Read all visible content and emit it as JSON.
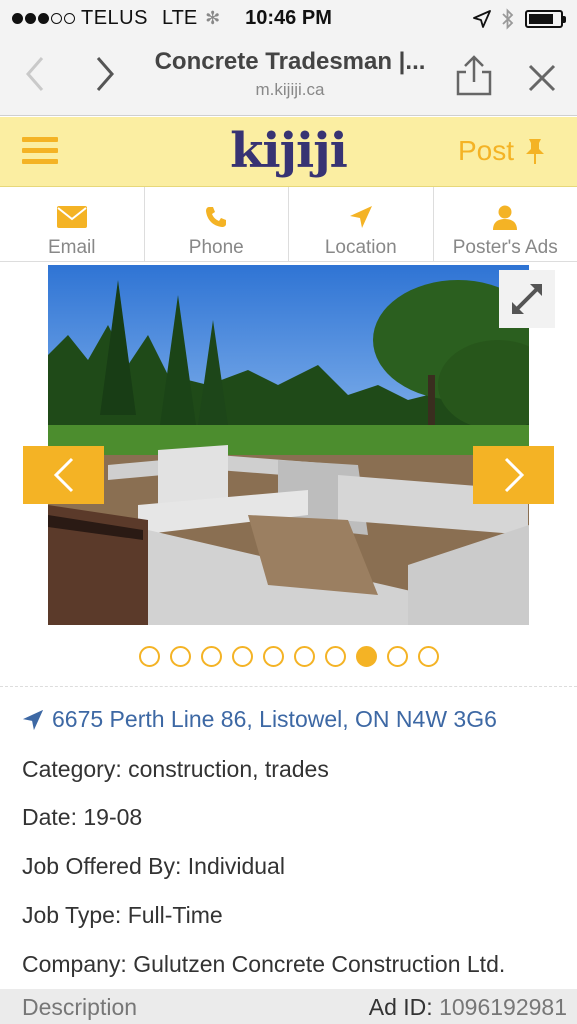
{
  "status_bar": {
    "carrier": "TELUS",
    "network": "LTE",
    "time": "10:46 PM"
  },
  "browser": {
    "title": "Concrete Tradesman |...",
    "url": "m.kijiji.ca"
  },
  "header": {
    "logo": "kijiji",
    "post_label": "Post"
  },
  "actions": [
    {
      "label": "Email",
      "icon": "envelope-icon"
    },
    {
      "label": "Phone",
      "icon": "phone-icon"
    },
    {
      "label": "Location",
      "icon": "location-arrow-icon"
    },
    {
      "label": "Poster's Ads",
      "icon": "user-icon"
    }
  ],
  "gallery": {
    "total_photos": 10,
    "current_photo": 8
  },
  "listing": {
    "address": "6675 Perth Line 86, Listowel, ON N4W 3G6",
    "category": "Category: construction, trades",
    "date": "Date: 19-08",
    "offered_by": "Job Offered By: Individual",
    "job_type": "Job Type: Full-Time",
    "company": "Company: Gulutzen Concrete Construction Ltd."
  },
  "footer": {
    "description_label": "Description",
    "ad_id_label": "Ad ID:",
    "ad_id_value": "1096192981"
  },
  "colors": {
    "accent": "#f4b325",
    "header_bg": "#fbeea2",
    "logo": "#373373",
    "link": "#3d68a4"
  }
}
